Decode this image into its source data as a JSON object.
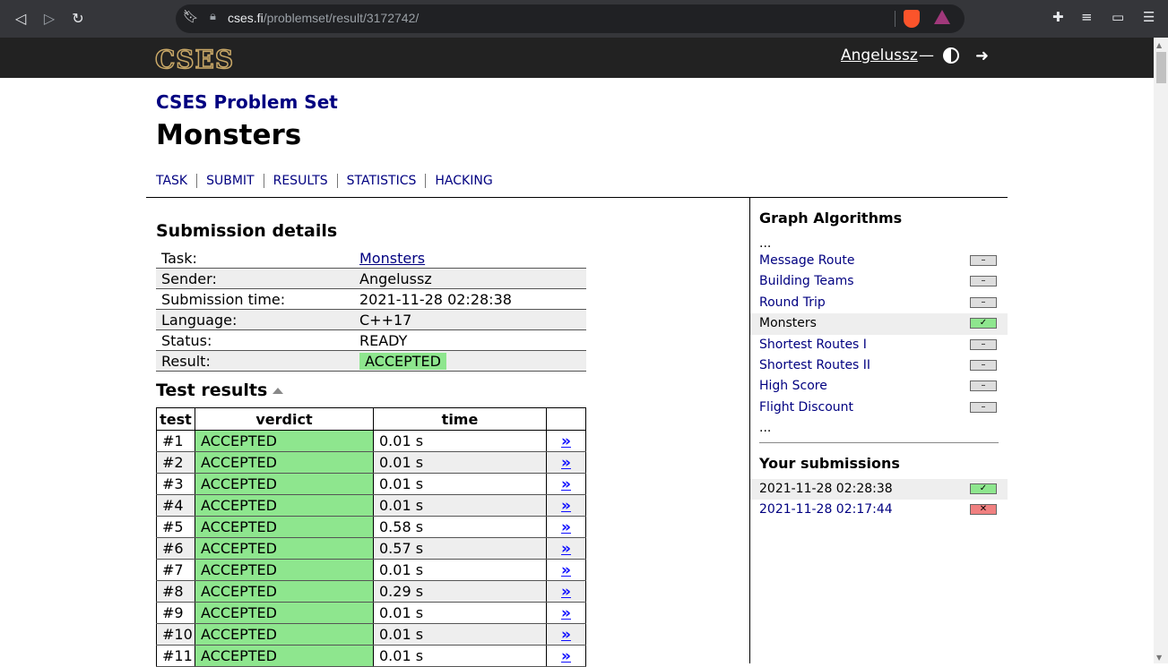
{
  "browser": {
    "url_host": "cses.fi",
    "url_path": "/problemset/result/3172742/"
  },
  "header": {
    "logo": "CSES",
    "user": "Angelussz",
    "dash": "—"
  },
  "page": {
    "problemset_title": "CSES Problem Set",
    "problem_title": "Monsters",
    "tabs": [
      "TASK",
      "SUBMIT",
      "RESULTS",
      "STATISTICS",
      "HACKING"
    ]
  },
  "submission": {
    "heading": "Submission details",
    "rows": [
      {
        "label": "Task:",
        "value": "Monsters"
      },
      {
        "label": "Sender:",
        "value": "Angelussz"
      },
      {
        "label": "Submission time:",
        "value": "2021-11-28 02:28:38"
      },
      {
        "label": "Language:",
        "value": "C++17"
      },
      {
        "label": "Status:",
        "value": "READY"
      },
      {
        "label": "Result:",
        "value": "ACCEPTED"
      }
    ]
  },
  "tests": {
    "heading": "Test results",
    "columns": [
      "test",
      "verdict",
      "time"
    ],
    "link_glyph": "»",
    "rows": [
      {
        "test": "#1",
        "verdict": "ACCEPTED",
        "time": "0.01 s"
      },
      {
        "test": "#2",
        "verdict": "ACCEPTED",
        "time": "0.01 s"
      },
      {
        "test": "#3",
        "verdict": "ACCEPTED",
        "time": "0.01 s"
      },
      {
        "test": "#4",
        "verdict": "ACCEPTED",
        "time": "0.01 s"
      },
      {
        "test": "#5",
        "verdict": "ACCEPTED",
        "time": "0.58 s"
      },
      {
        "test": "#6",
        "verdict": "ACCEPTED",
        "time": "0.57 s"
      },
      {
        "test": "#7",
        "verdict": "ACCEPTED",
        "time": "0.01 s"
      },
      {
        "test": "#8",
        "verdict": "ACCEPTED",
        "time": "0.29 s"
      },
      {
        "test": "#9",
        "verdict": "ACCEPTED",
        "time": "0.01 s"
      },
      {
        "test": "#10",
        "verdict": "ACCEPTED",
        "time": "0.01 s"
      },
      {
        "test": "#11",
        "verdict": "ACCEPTED",
        "time": "0.01 s"
      }
    ]
  },
  "sidebar": {
    "section_title": "Graph Algorithms",
    "ellipsis": "...",
    "problems": [
      {
        "name": "Message Route",
        "status": "none",
        "mark": "–"
      },
      {
        "name": "Building Teams",
        "status": "none",
        "mark": "–"
      },
      {
        "name": "Round Trip",
        "status": "none",
        "mark": "–"
      },
      {
        "name": "Monsters",
        "status": "ok",
        "mark": "✓",
        "current": true
      },
      {
        "name": "Shortest Routes I",
        "status": "none",
        "mark": "–"
      },
      {
        "name": "Shortest Routes II",
        "status": "none",
        "mark": "–"
      },
      {
        "name": "High Score",
        "status": "none",
        "mark": "–"
      },
      {
        "name": "Flight Discount",
        "status": "none",
        "mark": "–"
      }
    ],
    "submissions_title": "Your submissions",
    "submissions": [
      {
        "time": "2021-11-28 02:28:38",
        "status": "ok",
        "mark": "✓",
        "current": true
      },
      {
        "time": "2021-11-28 02:17:44",
        "status": "fail",
        "mark": "✕"
      }
    ]
  }
}
